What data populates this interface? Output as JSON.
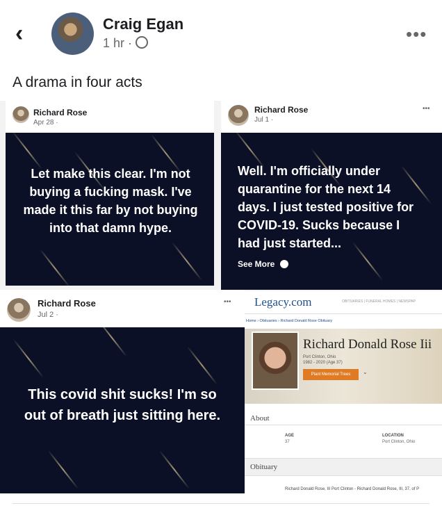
{
  "post": {
    "author": "Craig Egan",
    "time": "1 hr",
    "separator": "·",
    "caption": "A drama in four acts",
    "more_icon": "•••",
    "back_icon": "‹"
  },
  "panels": {
    "p1": {
      "name": "Richard Rose",
      "date": "Apr 28 ·",
      "text": "Let make this clear. I'm not buying a fucking mask. I've made it this far by not buying into that damn hype."
    },
    "p2": {
      "name": "Richard Rose",
      "date": "Jul 1 ·",
      "more": "•••",
      "text": "Well. I'm officially under quarantine for the next 14 days. I just tested positive for COVID-19. Sucks because I had just started...",
      "see_more": "See More"
    },
    "p3": {
      "name": "Richard Rose",
      "date": "Jul 2 ·",
      "more": "•••",
      "text": "This covid shit sucks! I'm so out of breath just sitting here."
    },
    "legacy": {
      "logo": "Legacy.com",
      "nav": "OBITUARIES | FUNERAL HOMES | NEWSPAP",
      "breadcrumb": "Home › Obituaries › Richard Donald Rose Obituary",
      "name": "Richard Donald Rose Iii",
      "location": "Port Clinton, Ohio",
      "years": "1982 - 2020 (Age 37)",
      "button": "Plant Memorial Trees",
      "about": "About",
      "age_label": "AGE",
      "age_value": "37",
      "loc_label": "LOCATION",
      "loc_value": "Port Clinton, Ohio",
      "obituary": "Obituary",
      "obit_text": "Richard Donald Rose, III Port Clinton - Richard Donald Rose, III, 37, of P"
    }
  },
  "colors": {
    "panel_bg": "#0b1026",
    "legacy_orange": "#e07b24",
    "legacy_blue": "#1f4e8c"
  }
}
